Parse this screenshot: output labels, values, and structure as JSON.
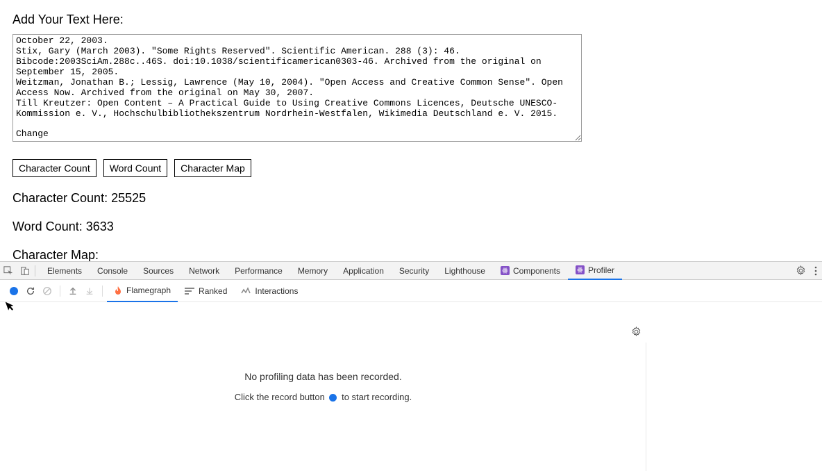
{
  "app": {
    "heading": "Add Your Text Here:",
    "textarea_value": "October 22, 2003.\nStix, Gary (March 2003). \"Some Rights Reserved\". Scientific American. 288 (3): 46. Bibcode:2003SciAm.288c..46S. doi:10.1038/scientificamerican0303-46. Archived from the original on September 15, 2005.\nWeitzman, Jonathan B.; Lessig, Lawrence (May 10, 2004). \"Open Access and Creative Common Sense\". Open Access Now. Archived from the original on May 30, 2007.\nTill Kreutzer: Open Content – A Practical Guide to Using Creative Commons Licences, Deutsche UNESCO-Kommission e. V., Hochschulbibliothekszentrum Nordrhein-Westfalen, Wikimedia Deutschland e. V. 2015.\n\nChange",
    "buttons": {
      "char_count": "Character Count",
      "word_count": "Word Count",
      "char_map": "Character Map"
    },
    "results": {
      "char_count_label": "Character Count: 25525",
      "word_count_label": "Word Count: 3633",
      "char_map_label": "Character Map:"
    }
  },
  "devtools": {
    "tabs": {
      "elements": "Elements",
      "console": "Console",
      "sources": "Sources",
      "network": "Network",
      "performance": "Performance",
      "memory": "Memory",
      "application": "Application",
      "security": "Security",
      "lighthouse": "Lighthouse",
      "components": "Components",
      "profiler": "Profiler"
    },
    "profiler_tabs": {
      "flamegraph": "Flamegraph",
      "ranked": "Ranked",
      "interactions": "Interactions"
    },
    "profiler_msg": {
      "main": "No profiling data has been recorded.",
      "sub_before": "Click the record button",
      "sub_after": "to start recording."
    }
  }
}
